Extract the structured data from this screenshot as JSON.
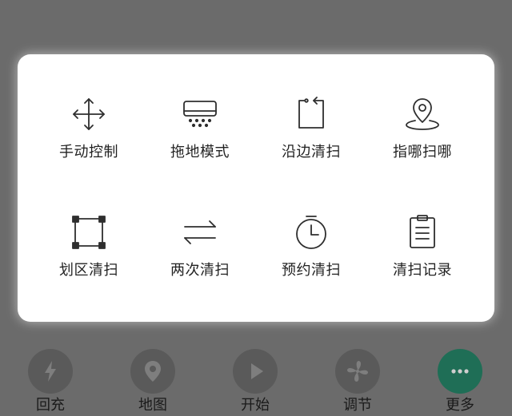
{
  "colors": {
    "backdrop": "#6b6b6b",
    "panel": "#ffffff",
    "icon_stroke": "#2e2e2e",
    "nav_circle": "#5a5a5a",
    "nav_active": "#1f6e56",
    "nav_glyph": "#7e7e7e"
  },
  "menu": {
    "items": [
      {
        "label": "手动控制",
        "icon": "move-arrows-icon"
      },
      {
        "label": "拖地模式",
        "icon": "mop-air-icon"
      },
      {
        "label": "沿边清扫",
        "icon": "edge-clean-icon"
      },
      {
        "label": "指哪扫哪",
        "icon": "location-pin-icon"
      },
      {
        "label": "划区清扫",
        "icon": "zone-select-icon"
      },
      {
        "label": "两次清扫",
        "icon": "swap-arrows-icon"
      },
      {
        "label": "预约清扫",
        "icon": "timer-icon"
      },
      {
        "label": "清扫记录",
        "icon": "clipboard-icon"
      }
    ]
  },
  "nav": {
    "items": [
      {
        "label": "回充",
        "icon": "lightning-icon",
        "active": false
      },
      {
        "label": "地图",
        "icon": "map-pin-icon",
        "active": false
      },
      {
        "label": "开始",
        "icon": "play-icon",
        "active": false
      },
      {
        "label": "调节",
        "icon": "fan-icon",
        "active": false
      },
      {
        "label": "更多",
        "icon": "more-dots-icon",
        "active": true
      }
    ]
  }
}
